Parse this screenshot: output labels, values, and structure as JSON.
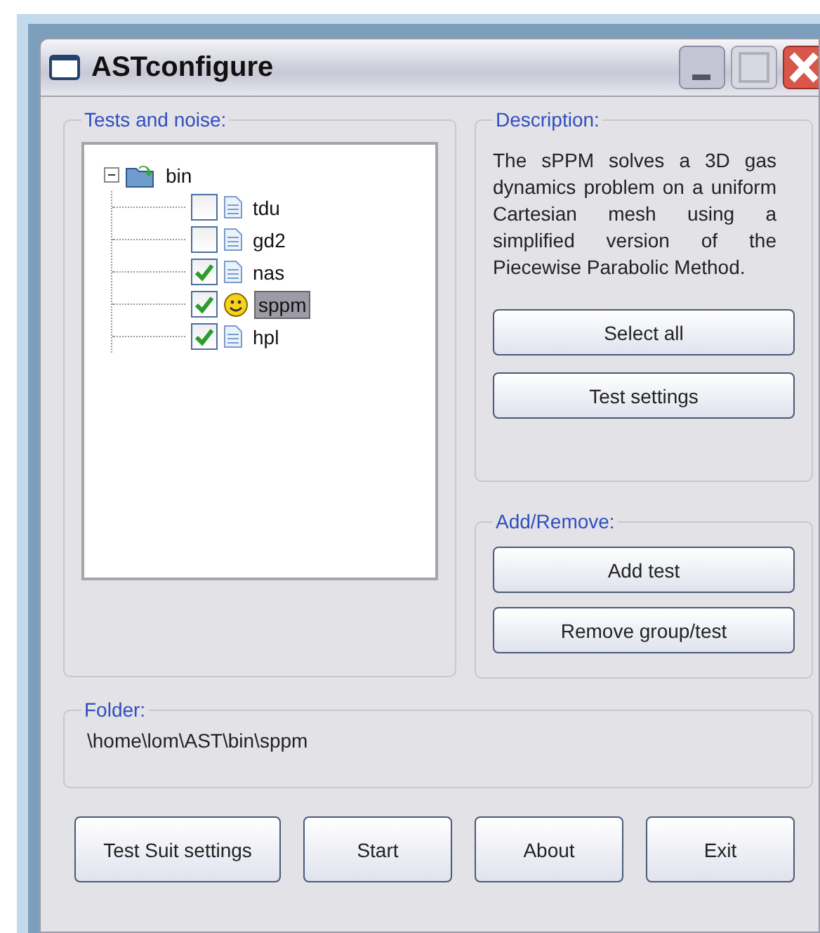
{
  "window": {
    "title": "ASTconfigure"
  },
  "tests": {
    "legend": "Tests and noise:",
    "root": {
      "label": "bin",
      "expanded": true,
      "children": [
        {
          "label": "tdu",
          "checked": false,
          "selected": false,
          "kind": "file"
        },
        {
          "label": "gd2",
          "checked": false,
          "selected": false,
          "kind": "file"
        },
        {
          "label": "nas",
          "checked": true,
          "selected": false,
          "kind": "file"
        },
        {
          "label": "sppm",
          "checked": true,
          "selected": true,
          "kind": "smiley"
        },
        {
          "label": "hpl",
          "checked": true,
          "selected": false,
          "kind": "file"
        }
      ]
    }
  },
  "description": {
    "legend": "Description:",
    "text": "The sPPM solves a 3D gas dynamics problem on a uniform Cartesian mesh using a simplified version of the Piecewise Parabolic Method.",
    "buttons": [
      "Select all",
      "Test settings"
    ]
  },
  "add_remove": {
    "legend": "Add/Remove:",
    "buttons": [
      "Add test",
      "Remove group/test"
    ]
  },
  "folder": {
    "legend": "Folder:",
    "path": "\\home\\lom\\AST\\bin\\sppm"
  },
  "buttons": [
    "Test Suit settings",
    "Start",
    "About",
    "Exit"
  ]
}
